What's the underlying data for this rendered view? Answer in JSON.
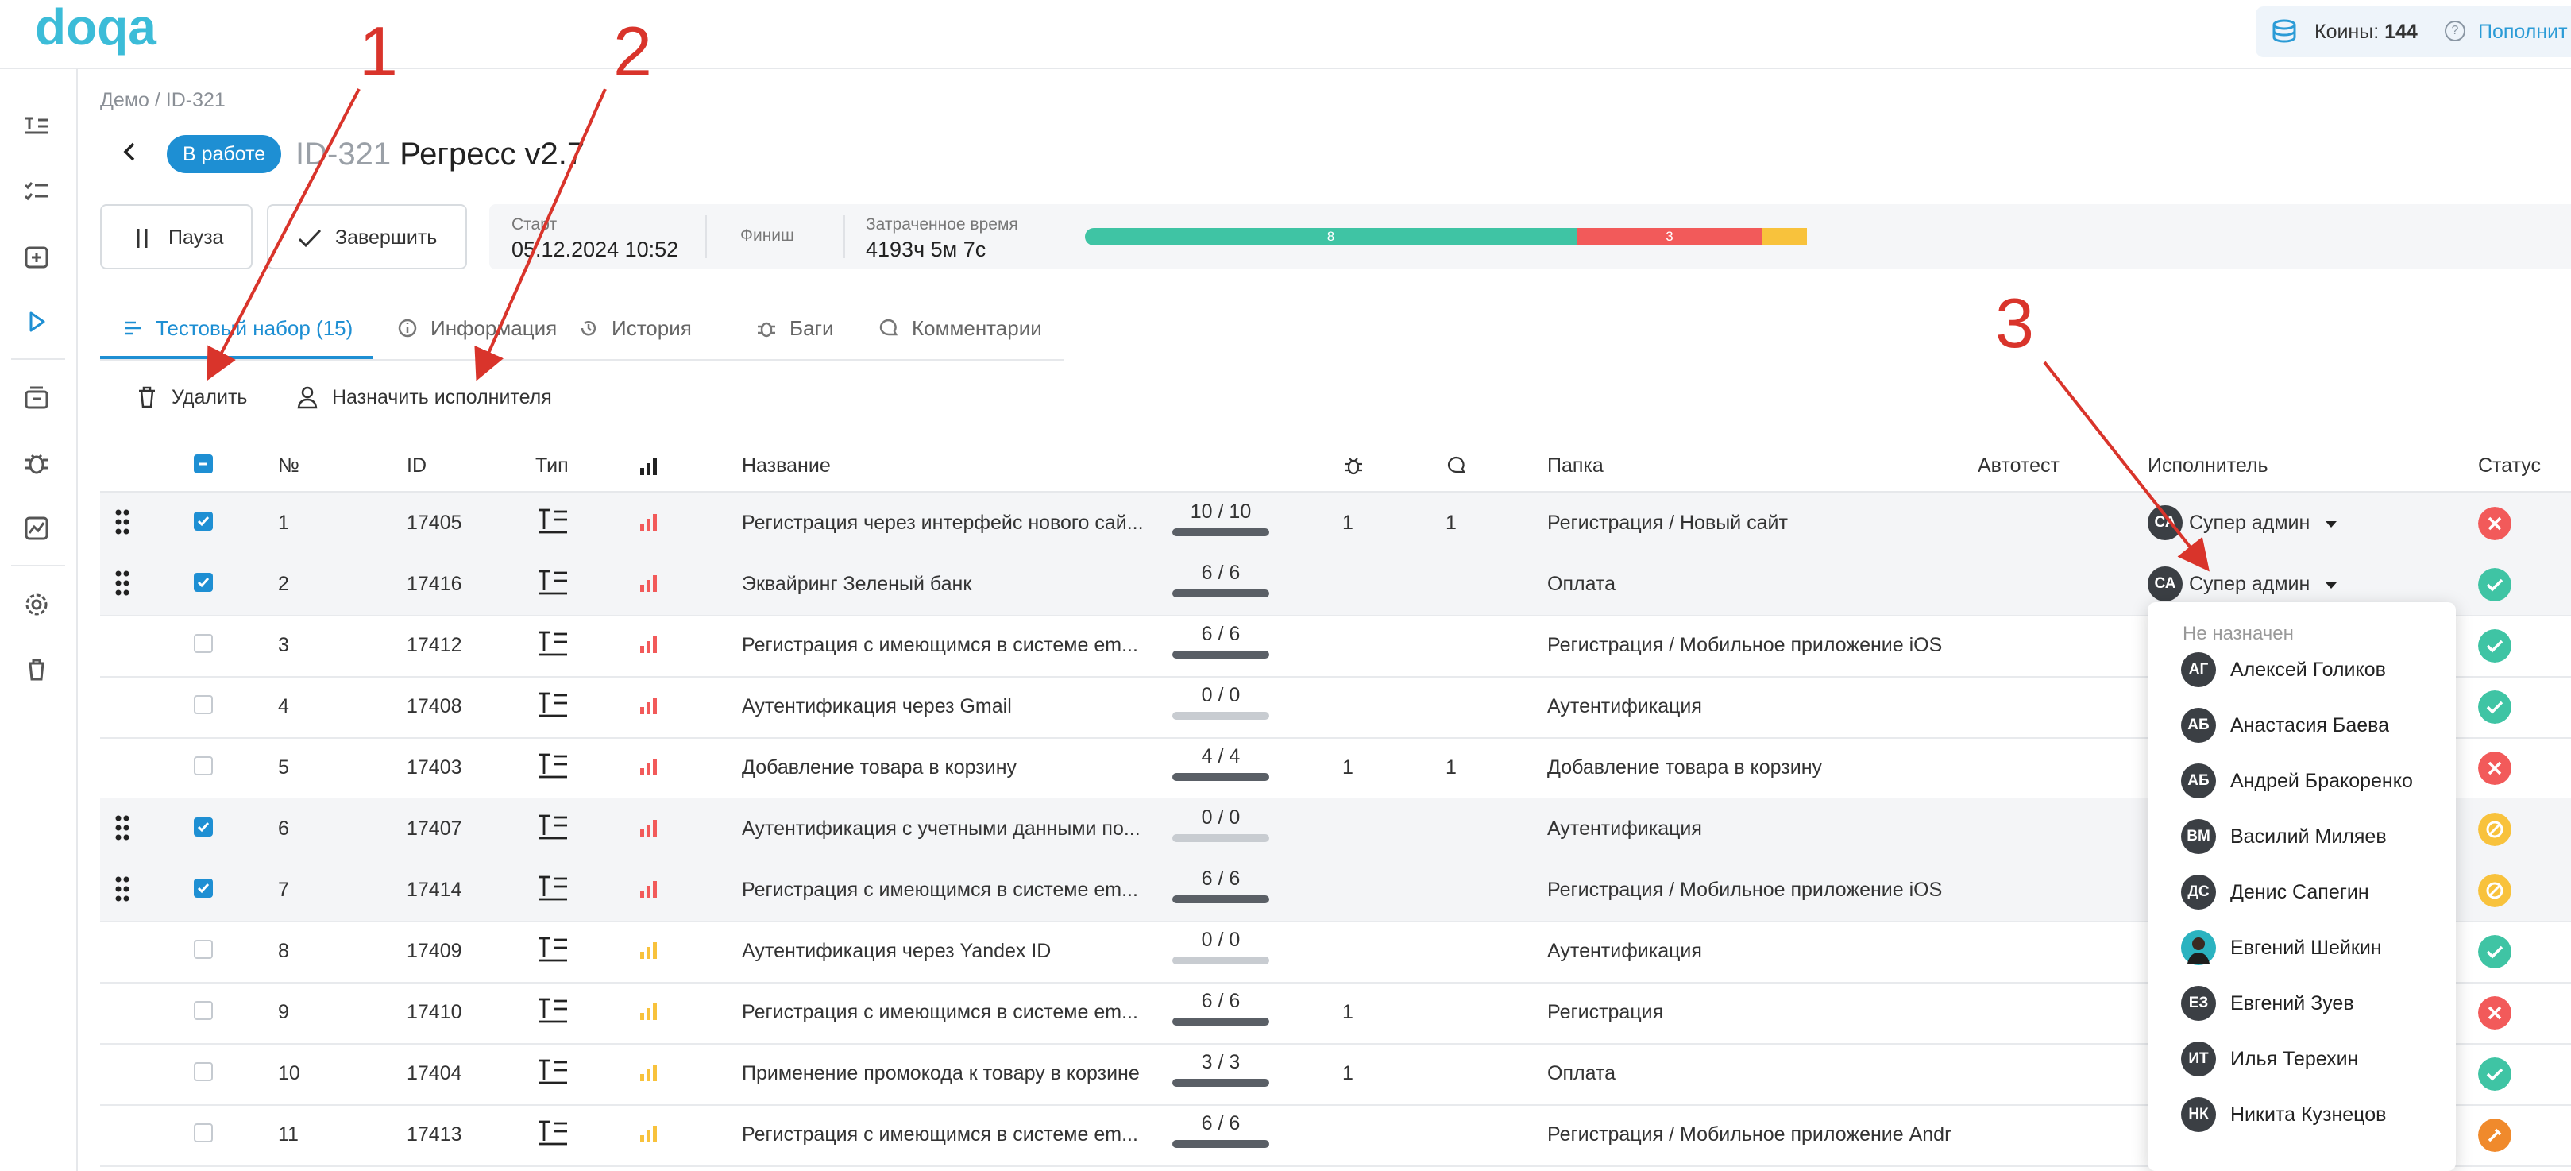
{
  "app": {
    "logo_text": "doqa"
  },
  "coins": {
    "label": "Коины:",
    "value": "144",
    "topup_label": "Пополнит"
  },
  "breadcrumb": "Демо / ID-321",
  "run": {
    "status": "В работе",
    "id": "ID-321",
    "title": "Регресс v2.7"
  },
  "toolbar": {
    "pause_label": "Пауза",
    "finish_label": "Завершить"
  },
  "info": {
    "start_label": "Старт",
    "start_value": "05.12.2024 10:52",
    "finish_label": "Финиш",
    "elapsed_label": "Затраченное время",
    "elapsed_value": "4193ч 5м 7с"
  },
  "progress": {
    "segments": [
      {
        "label": "8",
        "fraction": 0.331,
        "color": "#3fc4a4"
      },
      {
        "label": "3",
        "fraction": 0.125,
        "color": "#f25a5a"
      },
      {
        "label": "",
        "fraction": 0.03,
        "color": "#f8c23c"
      }
    ]
  },
  "tabs": [
    {
      "label": "Тестовый набор (15)",
      "icon": "list-icon",
      "active": true
    },
    {
      "label": "Информация",
      "icon": "info-icon"
    },
    {
      "label": "История",
      "icon": "history-icon"
    },
    {
      "label": "Баги",
      "icon": "bug-icon"
    },
    {
      "label": "Комментарии",
      "icon": "comment-icon"
    }
  ],
  "actions": {
    "delete_label": "Удалить",
    "assign_label": "Назначить исполнителя"
  },
  "table": {
    "headers": {
      "num": "№",
      "id": "ID",
      "type": "Тип",
      "name": "Название",
      "folder": "Папка",
      "autotest": "Автотест",
      "assignee": "Исполнитель",
      "status": "Статус"
    },
    "rows": [
      {
        "num": "1",
        "id": "17405",
        "name": "Регистрация через интерфейс нового сай...",
        "steps": "10 / 10",
        "bugs": "1",
        "comments": "1",
        "folder": "Регистрация / Новый сайт",
        "assignee": "Супер админ",
        "assignee_initials": "СА",
        "checked": true,
        "priority": "high",
        "status": "fail"
      },
      {
        "num": "2",
        "id": "17416",
        "name": "Эквайринг Зеленый банк",
        "steps": "6 / 6",
        "bugs": "",
        "comments": "",
        "folder": "Оплата",
        "assignee": "Супер админ",
        "assignee_initials": "СА",
        "checked": true,
        "priority": "high",
        "status": "pass"
      },
      {
        "num": "3",
        "id": "17412",
        "name": "Регистрация с имеющимся в системе em...",
        "steps": "6 / 6",
        "bugs": "",
        "comments": "",
        "folder": "Регистрация / Мобильное приложение iOS",
        "assignee": "",
        "checked": false,
        "priority": "high",
        "status": "pass"
      },
      {
        "num": "4",
        "id": "17408",
        "name": "Аутентификация через Gmail",
        "steps": "0 / 0",
        "bugs": "",
        "comments": "",
        "folder": "Аутентификация",
        "assignee": "",
        "checked": false,
        "priority": "high",
        "status": "pass"
      },
      {
        "num": "5",
        "id": "17403",
        "name": "Добавление товара в корзину",
        "steps": "4 / 4",
        "bugs": "1",
        "comments": "1",
        "folder": "Добавление товара в корзину",
        "assignee": "",
        "checked": false,
        "priority": "high",
        "status": "fail"
      },
      {
        "num": "6",
        "id": "17407",
        "name": "Аутентификация с учетными данными по...",
        "steps": "0 / 0",
        "bugs": "",
        "comments": "",
        "folder": "Аутентификация",
        "assignee": "",
        "checked": true,
        "priority": "high",
        "status": "skip"
      },
      {
        "num": "7",
        "id": "17414",
        "name": "Регистрация с имеющимся в системе em...",
        "steps": "6 / 6",
        "bugs": "",
        "comments": "",
        "folder": "Регистрация / Мобильное приложение iOS",
        "assignee": "",
        "checked": true,
        "priority": "high",
        "status": "skip"
      },
      {
        "num": "8",
        "id": "17409",
        "name": "Аутентификация через Yandex ID",
        "steps": "0 / 0",
        "bugs": "",
        "comments": "",
        "folder": "Аутентификация",
        "assignee": "",
        "checked": false,
        "priority": "medium",
        "status": "pass"
      },
      {
        "num": "9",
        "id": "17410",
        "name": "Регистрация с имеющимся в системе em...",
        "steps": "6 / 6",
        "bugs": "1",
        "comments": "",
        "folder": "Регистрация",
        "assignee": "",
        "checked": false,
        "priority": "medium",
        "status": "fail"
      },
      {
        "num": "10",
        "id": "17404",
        "name": "Применение промокода к товару в корзине",
        "steps": "3 / 3",
        "bugs": "1",
        "comments": "",
        "folder": "Оплата",
        "assignee": "",
        "checked": false,
        "priority": "medium",
        "status": "pass"
      },
      {
        "num": "11",
        "id": "17413",
        "name": "Регистрация с имеющимся в системе em...",
        "steps": "6 / 6",
        "bugs": "",
        "comments": "",
        "folder": "Регистрация / Мобильное приложение Andr",
        "assignee": "",
        "checked": false,
        "priority": "medium",
        "status": "blocked"
      }
    ]
  },
  "assignee_dropdown": {
    "none_label": "Не назначен",
    "users": [
      {
        "initials": "АГ",
        "name": "Алексей Голиков"
      },
      {
        "initials": "АБ",
        "name": "Анастасия Баева"
      },
      {
        "initials": "АБ",
        "name": "Андрей Бракоренко"
      },
      {
        "initials": "ВМ",
        "name": "Василий Миляев"
      },
      {
        "initials": "ДС",
        "name": "Денис Сапегин"
      },
      {
        "initials": "",
        "name": "Евгений Шейкин",
        "photo": true
      },
      {
        "initials": "ЕЗ",
        "name": "Евгений Зуев"
      },
      {
        "initials": "ИТ",
        "name": "Илья Терехин"
      },
      {
        "initials": "НК",
        "name": "Никита Кузнецов"
      }
    ]
  },
  "annotations": [
    "1",
    "2",
    "3"
  ],
  "colors": {
    "accent": "#1e8fd3",
    "pass": "#3fc4a4",
    "fail": "#f25a5a",
    "skip": "#f8c23c",
    "blocked": "#f08a2c",
    "annotation": "#d9342b"
  }
}
